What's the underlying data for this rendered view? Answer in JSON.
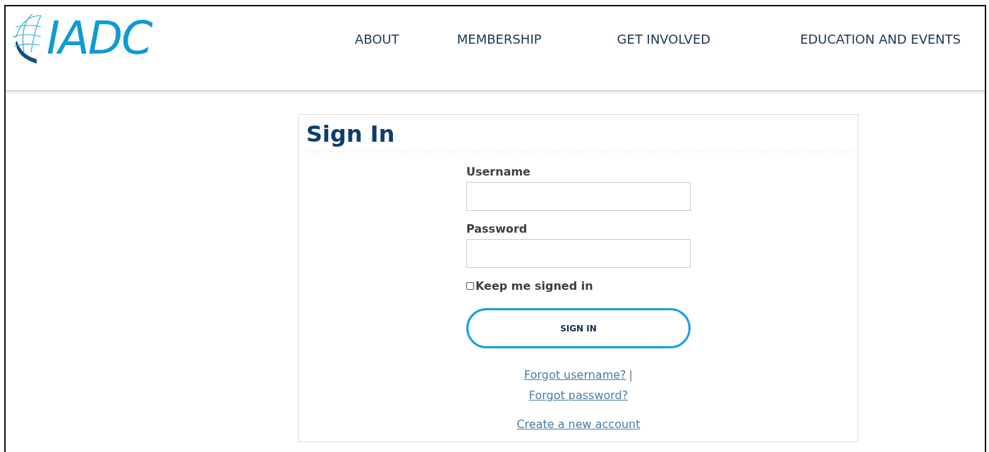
{
  "header": {
    "logo": "IADC",
    "nav": [
      {
        "label": "ABOUT"
      },
      {
        "label": "MEMBERSHIP"
      },
      {
        "label": "GET INVOLVED"
      },
      {
        "label": "EDUCATION AND EVENTS"
      }
    ]
  },
  "sign_in": {
    "title": "Sign In",
    "fields": [
      {
        "label": "Username"
      },
      {
        "label": "Password"
      }
    ],
    "remember": {
      "label": "Keep me signed in",
      "checked": false
    },
    "button": "SIGN IN",
    "links": [
      {
        "label": "Forgot username?",
        "separator": "|"
      },
      {
        "label": "Forgot password?"
      },
      {
        "label": "Create a new account"
      }
    ]
  }
}
